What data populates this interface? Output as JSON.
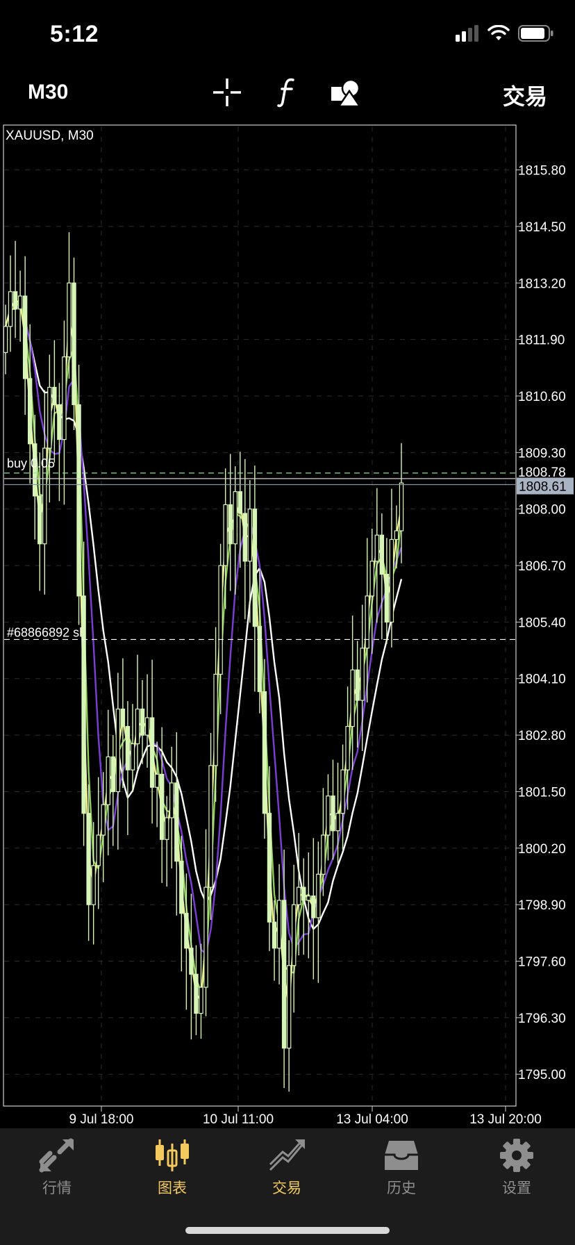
{
  "status_bar": {
    "time": "5:12"
  },
  "toolbar": {
    "timeframe": "M30",
    "crosshair_icon": "crosshair-icon",
    "indicators_icon": "function-icon",
    "objects_icon": "shapes-icon",
    "trade_label": "交易"
  },
  "chart": {
    "symbol_label": "XAUUSD, M30",
    "buy_line_label": "buy 0.05",
    "sl_line_label": "#68866892 sl",
    "current_price": "1808.61",
    "buy_price_tag": "1808.78",
    "price_axis": [
      "1815.80",
      "1814.50",
      "1813.20",
      "1811.90",
      "1810.60",
      "1809.30",
      "1808.00",
      "1806.70",
      "1805.40",
      "1804.10",
      "1802.80",
      "1801.50",
      "1800.20",
      "1798.90",
      "1797.60",
      "1796.30",
      "1795.00"
    ],
    "time_axis": [
      "9 Jul 18:00",
      "10 Jul 11:00",
      "13 Jul 04:00",
      "13 Jul 20:00"
    ],
    "colors": {
      "background": "#000000",
      "candle": "#d8f5b8",
      "ma_purple": "#7b3fd6",
      "ma_yellow": "#f0f08a",
      "ma_green": "#8fcf5a",
      "ma_white": "#ffffff",
      "current_price_bg": "#a8b4c4",
      "accent": "#f4c95d"
    }
  },
  "chart_data": {
    "type": "candlestick",
    "title": "XAUUSD, M30",
    "ylim": [
      1794.3,
      1816.8
    ],
    "close": [
      1812.2,
      1813.0,
      1812.6,
      1812.9,
      1811.0,
      1809.5,
      1808.3,
      1807.2,
      1809.4,
      1810.8,
      1810.4,
      1809.6,
      1811.5,
      1813.2,
      1810.4,
      1806.0,
      1801.0,
      1798.9,
      1799.8,
      1800.5,
      1801.2,
      1802.3,
      1801.5,
      1803.4,
      1803.0,
      1802.0,
      1802.6,
      1803.4,
      1802.8,
      1803.2,
      1801.6,
      1801.9,
      1800.4,
      1800.9,
      1801.7,
      1799.9,
      1798.7,
      1797.9,
      1797.3,
      1796.4,
      1797.0,
      1799.3,
      1802.1,
      1804.2,
      1806.7,
      1808.1,
      1807.2,
      1808.4,
      1807.9,
      1806.8,
      1808.0,
      1805.3,
      1803.8,
      1801.0,
      1798.5,
      1797.9,
      1799.0,
      1795.6,
      1797.5,
      1798.9,
      1799.3,
      1799.0,
      1799.1,
      1798.6,
      1799.6,
      1800.5,
      1801.4,
      1800.6,
      1801.0,
      1802.0,
      1803.0,
      1804.3,
      1803.6,
      1804.8,
      1806.0,
      1806.8,
      1807.4,
      1806.5,
      1805.4,
      1807.3,
      1807.5,
      1808.6
    ]
  },
  "bottom_nav": {
    "items": [
      {
        "label": "行情",
        "icon": "quotes-icon"
      },
      {
        "label": "图表",
        "icon": "chart-icon"
      },
      {
        "label": "交易",
        "icon": "trade-icon"
      },
      {
        "label": "历史",
        "icon": "history-icon"
      },
      {
        "label": "设置",
        "icon": "gear-icon"
      }
    ]
  }
}
